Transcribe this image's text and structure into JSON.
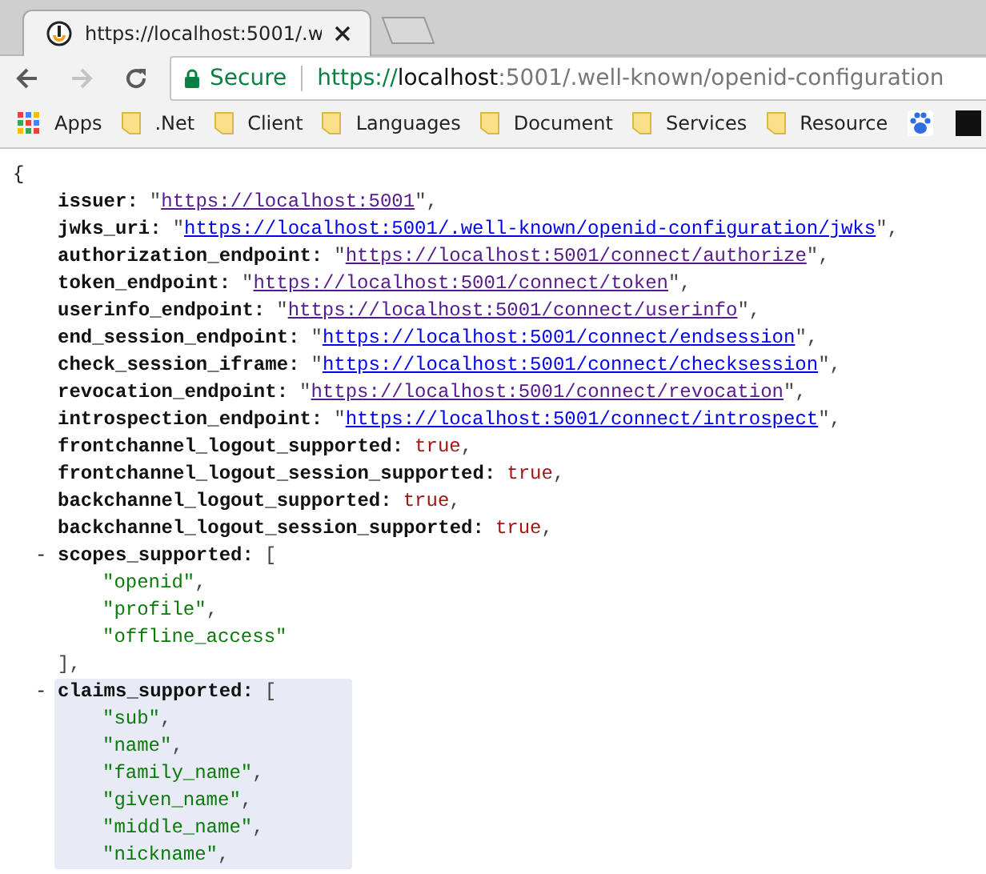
{
  "tab_strip": {
    "tab": {
      "title": "https://localhost:5001/.w",
      "selected": true
    }
  },
  "toolbar": {
    "back_enabled": true,
    "forward_enabled": false,
    "security_label": "Secure",
    "url": {
      "scheme": "https://",
      "host": "localhost",
      "rest": ":5001/.well-known/openid-configuration"
    }
  },
  "bookmarks": [
    {
      "kind": "apps",
      "label": "Apps"
    },
    {
      "kind": "folder",
      "label": ".Net"
    },
    {
      "kind": "folder",
      "label": "Client"
    },
    {
      "kind": "folder",
      "label": "Languages"
    },
    {
      "kind": "folder",
      "label": "Document"
    },
    {
      "kind": "folder",
      "label": "Services"
    },
    {
      "kind": "folder",
      "label": "Resource"
    },
    {
      "kind": "paw"
    },
    {
      "kind": "dark"
    }
  ],
  "json_view": {
    "open_brace": "{",
    "entries": [
      {
        "kind": "link",
        "key": "issuer:",
        "open": "\"",
        "value": "https://localhost:5001",
        "close": "\",",
        "visited": true
      },
      {
        "kind": "link",
        "key": "jwks_uri:",
        "open": "\"",
        "value": "https://localhost:5001/.well-known/openid-configuration/jwks",
        "close": "\",",
        "visited": false
      },
      {
        "kind": "link",
        "key": "authorization_endpoint:",
        "open": "\"",
        "value": "https://localhost:5001/connect/authorize",
        "close": "\",",
        "visited": true
      },
      {
        "kind": "link",
        "key": "token_endpoint:",
        "open": "\"",
        "value": "https://localhost:5001/connect/token",
        "close": "\",",
        "visited": true
      },
      {
        "kind": "link",
        "key": "userinfo_endpoint:",
        "open": "\"",
        "value": "https://localhost:5001/connect/userinfo",
        "close": "\",",
        "visited": true
      },
      {
        "kind": "link",
        "key": "end_session_endpoint:",
        "open": "\"",
        "value": "https://localhost:5001/connect/endsession",
        "close": "\",",
        "visited": false
      },
      {
        "kind": "link",
        "key": "check_session_iframe:",
        "open": "\"",
        "value": "https://localhost:5001/connect/checksession",
        "close": "\",",
        "visited": false
      },
      {
        "kind": "link",
        "key": "revocation_endpoint:",
        "open": "\"",
        "value": "https://localhost:5001/connect/revocation",
        "close": "\",",
        "visited": true
      },
      {
        "kind": "link",
        "key": "introspection_endpoint:",
        "open": "\"",
        "value": "https://localhost:5001/connect/introspect",
        "close": "\",",
        "visited": false
      },
      {
        "kind": "bool",
        "key": "frontchannel_logout_supported:",
        "value": "true",
        "close": ","
      },
      {
        "kind": "bool",
        "key": "frontchannel_logout_session_supported:",
        "value": "true",
        "close": ","
      },
      {
        "kind": "bool",
        "key": "backchannel_logout_supported:",
        "value": "true",
        "close": ","
      },
      {
        "kind": "bool",
        "key": "backchannel_logout_session_supported:",
        "value": "true",
        "close": ","
      },
      {
        "kind": "array",
        "toggle": "-",
        "key": "scopes_supported:",
        "open": "[",
        "highlighted": false,
        "items": [
          {
            "text": "\"openid\"",
            "sep": ","
          },
          {
            "text": "\"profile\"",
            "sep": ","
          },
          {
            "text": "\"offline_access\""
          }
        ],
        "close": "],"
      },
      {
        "kind": "array",
        "toggle": "-",
        "key": "claims_supported:",
        "open": "[",
        "highlighted": true,
        "items": [
          {
            "text": "\"sub\"",
            "sep": ","
          },
          {
            "text": "\"name\"",
            "sep": ","
          },
          {
            "text": "\"family_name\"",
            "sep": ","
          },
          {
            "text": "\"given_name\"",
            "sep": ","
          },
          {
            "text": "\"middle_name\"",
            "sep": ","
          },
          {
            "text": "\"nickname\"",
            "sep": ","
          }
        ]
      }
    ]
  }
}
